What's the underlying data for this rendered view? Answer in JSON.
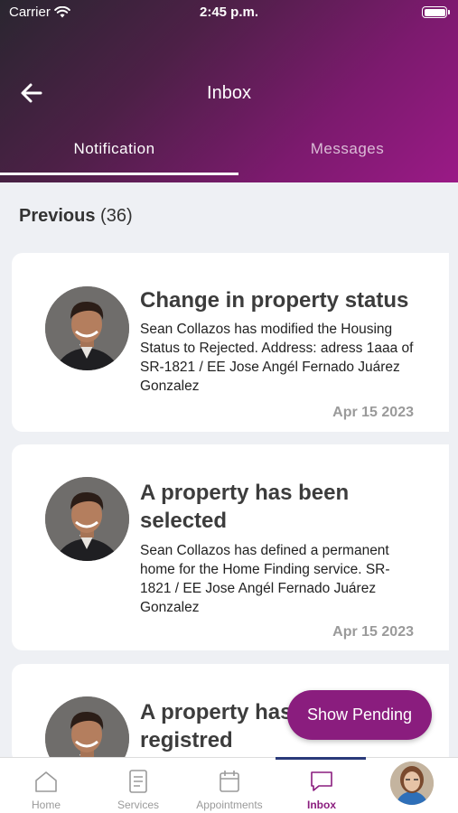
{
  "status_bar": {
    "carrier": "Carrier",
    "time": "2:45 p.m."
  },
  "header": {
    "title": "Inbox",
    "back_icon": "arrow-left-icon"
  },
  "tabs": [
    {
      "label": "Notification",
      "active": true
    },
    {
      "label": "Messages",
      "active": false
    }
  ],
  "section": {
    "label": "Previous",
    "count": "(36)"
  },
  "notifications": [
    {
      "title": "Change in property status",
      "body": "Sean Collazos has modified the Housing Status to Rejected. Address: adress 1aaa of SR-1821 / EE Jose Angél Fernado Juárez Gonzalez",
      "date": "Apr 15 2023"
    },
    {
      "title": "A property has been selected",
      "body": "Sean Collazos has defined a permanent home for the Home Finding service. SR-1821 / EE Jose Angél Fernado Juárez Gonzalez",
      "date": "Apr 15 2023"
    },
    {
      "title": "A property has been registred",
      "body": "",
      "date": ""
    }
  ],
  "fab": {
    "label": "Show Pending"
  },
  "tabbar": [
    {
      "label": "Home",
      "icon": "home-icon"
    },
    {
      "label": "Services",
      "icon": "document-icon"
    },
    {
      "label": "Appointments",
      "icon": "calendar-icon"
    },
    {
      "label": "Inbox",
      "icon": "chat-bubble-icon",
      "active": true
    }
  ],
  "colors": {
    "accent": "#8a1d7e",
    "header_start": "#2a2630",
    "header_end": "#9a1a86",
    "indicator": "#2a3a7a"
  }
}
